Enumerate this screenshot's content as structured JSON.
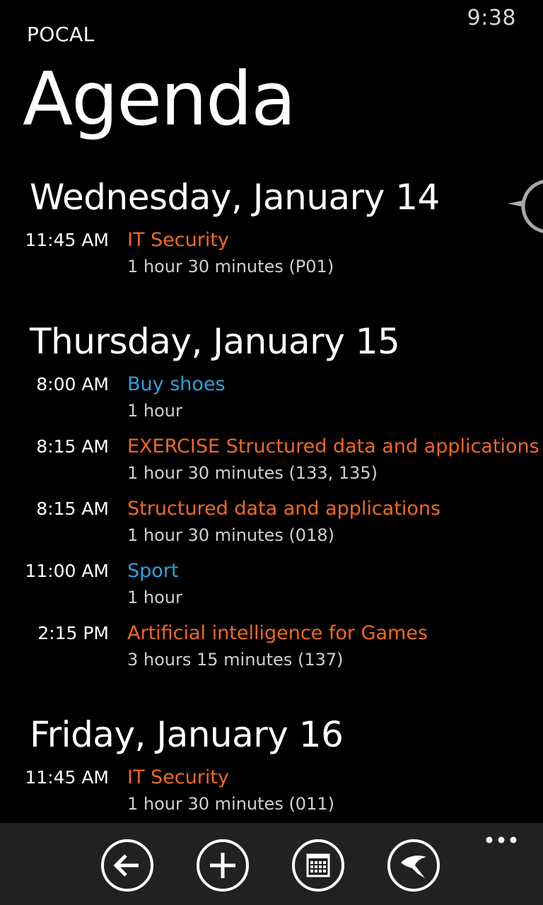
{
  "status_bar": {
    "time": "9:38"
  },
  "header": {
    "app_name": "POCAL",
    "title": "Agenda"
  },
  "colors": {
    "orange": "#f0691e",
    "blue": "#2ea2dc",
    "background": "#000000",
    "app_bar": "#212121"
  },
  "agenda": {
    "days": [
      {
        "header": "Wednesday, January 14",
        "events": [
          {
            "time": "11:45 AM",
            "title": "IT Security",
            "detail": "1 hour 30 minutes (P01)",
            "color": "#f0691e"
          }
        ]
      },
      {
        "header": "Thursday, January 15",
        "events": [
          {
            "time": "8:00 AM",
            "title": "Buy shoes",
            "detail": "1 hour",
            "color": "#2ea2dc"
          },
          {
            "time": "8:15 AM",
            "title": "EXERCISE Structured data and applications",
            "detail": "1 hour 30 minutes (133, 135)",
            "color": "#f0691e"
          },
          {
            "time": "8:15 AM",
            "title": "Structured data and applications",
            "detail": "1 hour 30 minutes (018)",
            "color": "#f0691e"
          },
          {
            "time": "11:00 AM",
            "title": "Sport",
            "detail": "1 hour",
            "color": "#2ea2dc"
          },
          {
            "time": "2:15 PM",
            "title": "Artificial intelligence for Games",
            "detail": "3 hours 15 minutes (137)",
            "color": "#f0691e"
          }
        ]
      },
      {
        "header": "Friday, January 16",
        "events": [
          {
            "time": "11:45 AM",
            "title": "IT Security",
            "detail": "1 hour 30 minutes (011)",
            "color": "#f0691e"
          }
        ]
      }
    ]
  },
  "app_bar": {
    "buttons": [
      {
        "icon": "back-arrow-icon"
      },
      {
        "icon": "add-icon"
      },
      {
        "icon": "calendar-icon"
      },
      {
        "icon": "swallow-icon"
      }
    ],
    "more": "ellipsis-icon"
  }
}
